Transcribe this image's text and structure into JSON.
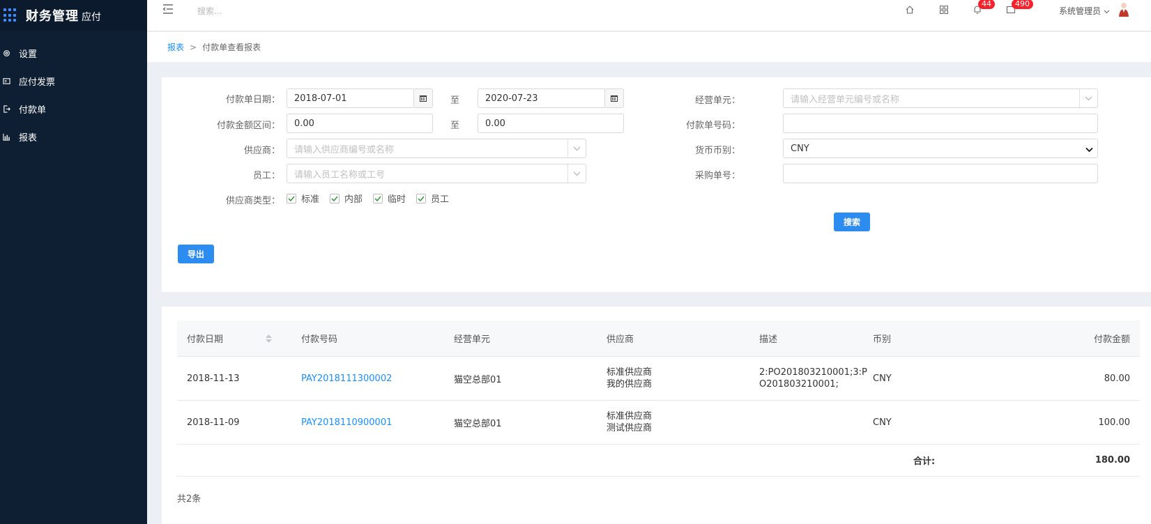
{
  "app": {
    "title": "财务管理",
    "subtitle": "应付"
  },
  "sidebar": {
    "items": [
      {
        "label": "设置",
        "icon": "gear-icon"
      },
      {
        "label": "应付发票",
        "icon": "invoice-icon"
      },
      {
        "label": "付款单",
        "icon": "payment-icon"
      },
      {
        "label": "报表",
        "icon": "chart-icon"
      }
    ]
  },
  "header": {
    "search_placeholder": "搜索...",
    "notifications_count": "44",
    "messages_count": "490",
    "user_name": "系统管理员"
  },
  "breadcrumb": {
    "root": "报表",
    "separator": ">",
    "current": "付款单查看报表"
  },
  "filters": {
    "payment_date_label": "付款单日期：",
    "date_from": "2018-07-01",
    "date_to": "2020-07-23",
    "to_label": "至",
    "amount_label": "付款金额区间：",
    "amount_from": "0.00",
    "amount_to": "0.00",
    "supplier_label": "供应商：",
    "supplier_placeholder": "请输入供应商编号或名称",
    "employee_label": "员工：",
    "employee_placeholder": "请输入员工名称或工号",
    "supplier_type_label": "供应商类型：",
    "supplier_types": [
      "标准",
      "内部",
      "临时",
      "员工"
    ],
    "business_unit_label": "经营单元：",
    "business_unit_placeholder": "请输入经营单元编号或名称",
    "payment_no_label": "付款单号码：",
    "payment_no_value": "",
    "currency_label": "货币币别：",
    "currency_value": "CNY",
    "po_no_label": "采购单号：",
    "po_no_value": "",
    "search_button": "搜索",
    "export_button": "导出"
  },
  "table": {
    "columns": [
      "付款日期",
      "付款号码",
      "经营单元",
      "供应商",
      "描述",
      "币别",
      "付款金额"
    ],
    "rows": [
      {
        "date": "2018-11-13",
        "number": "PAY2018111300002",
        "unit": "猫空总部01",
        "supplier_line1": "标准供应商",
        "supplier_line2": "我的供应商",
        "desc_line1": "2:PO201803210001;3:P",
        "desc_line2": "O201803210001;",
        "currency": "CNY",
        "amount": "80.00"
      },
      {
        "date": "2018-11-09",
        "number": "PAY2018110900001",
        "unit": "猫空总部01",
        "supplier_line1": "标准供应商",
        "supplier_line2": "测试供应商",
        "desc_line1": "",
        "desc_line2": "",
        "currency": "CNY",
        "amount": "100.00"
      }
    ],
    "total_label": "合计:",
    "total_value": "180.00",
    "count_text": "共2条"
  },
  "colors": {
    "sidebar_bg": "#0f1f33",
    "primary": "#2d8cf0",
    "link": "#1890ff",
    "badge": "#f5222d"
  }
}
